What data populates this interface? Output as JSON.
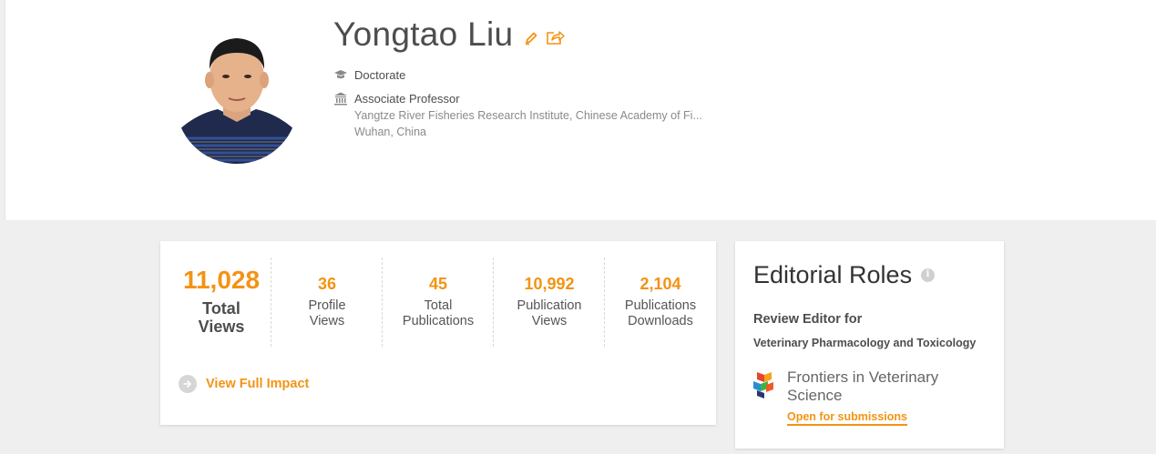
{
  "profile": {
    "name": "Yongtao Liu",
    "degree": "Doctorate",
    "position": "Associate Professor",
    "institution": "Yangtze River Fisheries Research Institute, Chinese Academy of Fi...",
    "location": "Wuhan, China"
  },
  "impact": {
    "total_views_value": "11,028",
    "total_views_label_1": "Total",
    "total_views_label_2": "Views",
    "stats": [
      {
        "value": "36",
        "label_1": "Profile",
        "label_2": "Views"
      },
      {
        "value": "45",
        "label_1": "Total",
        "label_2": "Publications"
      },
      {
        "value": "10,992",
        "label_1": "Publication",
        "label_2": "Views"
      },
      {
        "value": "2,104",
        "label_1": "Publications",
        "label_2": "Downloads"
      }
    ],
    "view_full_impact": "View Full Impact"
  },
  "editorial": {
    "title": "Editorial Roles",
    "info_icon_glyph": "i",
    "role_type": "Review Editor for",
    "section": "Veterinary Pharmacology and Toxicology",
    "journal_line_1": "Frontiers in Veterinary",
    "journal_line_2": "Science",
    "submit_link": "Open for submissions"
  },
  "colors": {
    "accent": "#f39314",
    "page_bg": "#efefef",
    "card_bg": "#ffffff"
  },
  "icons": {
    "edit": "pencil-icon",
    "share": "share-icon",
    "degree": "graduation-cap-icon",
    "institution": "institution-icon",
    "view_impact": "arrow-right-icon",
    "info": "info-icon",
    "journal": "frontiers-logo-icon"
  }
}
